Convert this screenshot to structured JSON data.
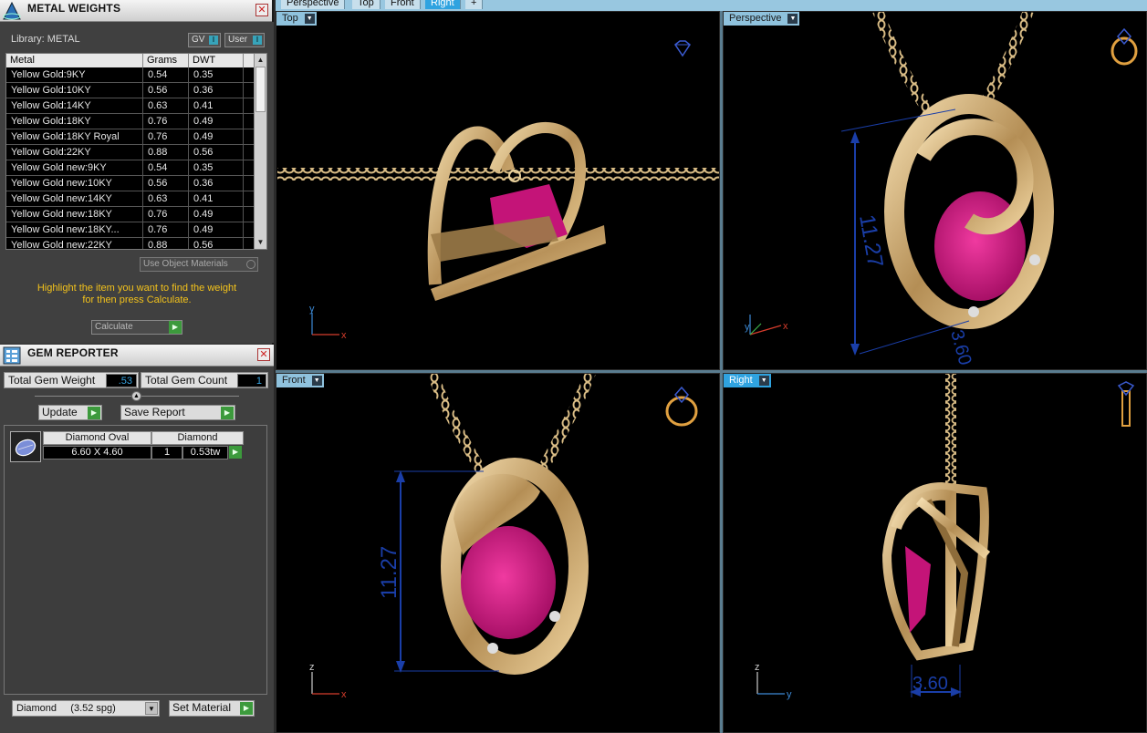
{
  "tabs": [
    "Perspective",
    "Top",
    "Front",
    "Right",
    "+"
  ],
  "active_tab": "Right",
  "metal_weights": {
    "title": "METAL WEIGHTS",
    "library_label": "Library: METAL",
    "toggle_gv": "GV",
    "toggle_user": "User",
    "columns": [
      "Metal",
      "Grams",
      "DWT"
    ],
    "rows": [
      [
        "Yellow Gold:9KY",
        "0.54",
        "0.35"
      ],
      [
        "Yellow Gold:10KY",
        "0.56",
        "0.36"
      ],
      [
        "Yellow Gold:14KY",
        "0.63",
        "0.41"
      ],
      [
        "Yellow Gold:18KY",
        "0.76",
        "0.49"
      ],
      [
        "Yellow Gold:18KY Royal",
        "0.76",
        "0.49"
      ],
      [
        "Yellow Gold:22KY",
        "0.88",
        "0.56"
      ],
      [
        "Yellow Gold new:9KY",
        "0.54",
        "0.35"
      ],
      [
        "Yellow Gold new:10KY",
        "0.56",
        "0.36"
      ],
      [
        "Yellow Gold new:14KY",
        "0.63",
        "0.41"
      ],
      [
        "Yellow Gold new:18KY",
        "0.76",
        "0.49"
      ],
      [
        "Yellow Gold new:18KY...",
        "0.76",
        "0.49"
      ],
      [
        "Yellow Gold new:22KY",
        "0.88",
        "0.56"
      ]
    ],
    "use_object_materials": "Use Object Materials",
    "hint_line1": "Highlight the item you want to find the weight",
    "hint_line2": "for then press Calculate.",
    "calculate_label": "Calculate"
  },
  "gem_reporter": {
    "title": "GEM REPORTER",
    "total_weight_label": "Total Gem Weight",
    "total_weight_value": ".53",
    "total_count_label": "Total Gem Count",
    "total_count_value": "1",
    "update_label": "Update",
    "save_report_label": "Save Report",
    "gem": {
      "shape": "Diamond Oval",
      "material": "Diamond",
      "size": "6.60 X 4.60",
      "count": "1",
      "weight": "0.53tw"
    },
    "material_select": "Diamond     (3.52 spg)",
    "set_material_label": "Set Material"
  },
  "viewports": {
    "top_label": "Top",
    "perspective_label": "Perspective",
    "front_label": "Front",
    "right_label": "Right",
    "dim_height": "11.27",
    "dim_width": "3.60"
  },
  "colors": {
    "gold": "#c9a76a",
    "gem": "#d0157d",
    "dimension": "#1a3ea8",
    "accent": "#2fa3e0"
  }
}
